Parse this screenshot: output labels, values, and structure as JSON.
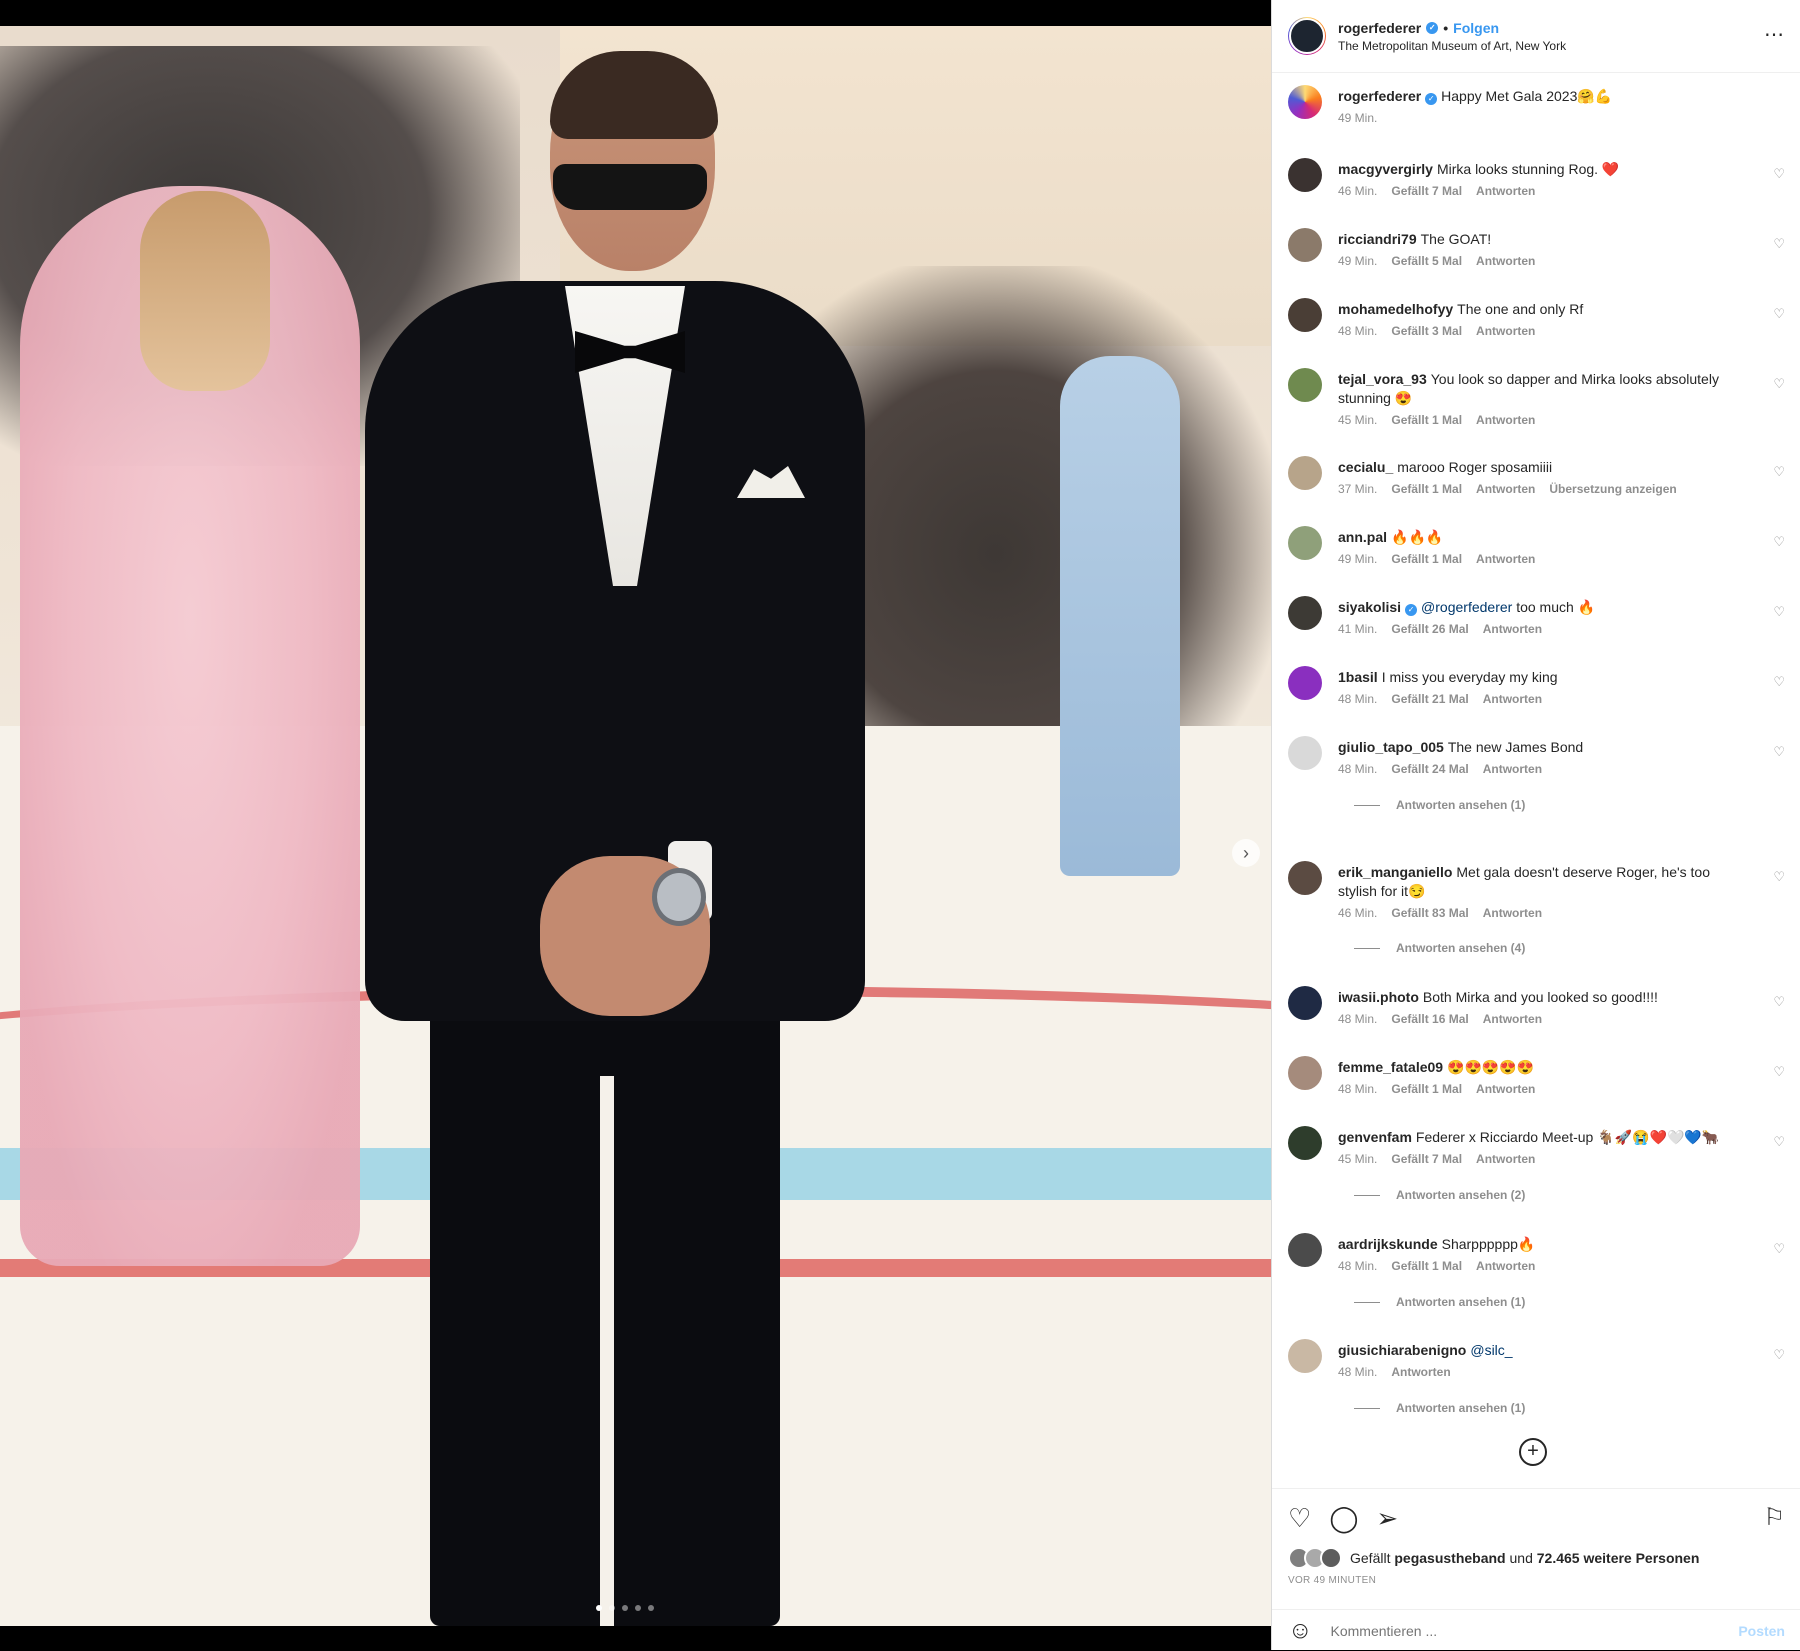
{
  "post": {
    "username": "rogerfederer",
    "follow_label": "Folgen",
    "separator": "•",
    "location": "The Metropolitan Museum of Art, New York",
    "more_icon": "⋯",
    "caption": "Happy Met Gala 2023🤗💪",
    "caption_time": "49 Min."
  },
  "colors": {
    "accent": "#3897f0",
    "text": "#262626",
    "muted": "#8e8e8e"
  },
  "comments": [
    {
      "user": "macgyvergirly",
      "text": "Mirka looks stunning Rog. ❤️",
      "time": "46 Min.",
      "likes": "Gefällt 7 Mal",
      "reply": "Antworten"
    },
    {
      "user": "ricciandri79",
      "text": "The GOAT!",
      "time": "49 Min.",
      "likes": "Gefällt 5 Mal",
      "reply": "Antworten"
    },
    {
      "user": "mohamedelhofyy",
      "text": "The one and only Rf",
      "time": "48 Min.",
      "likes": "Gefällt 3 Mal",
      "reply": "Antworten"
    },
    {
      "user": "tejal_vora_93",
      "text": "You look so dapper and Mirka looks absolutely stunning 😍",
      "time": "45 Min.",
      "likes": "Gefällt 1 Mal",
      "reply": "Antworten"
    },
    {
      "user": "cecialu_",
      "text": "marooo Roger sposamiiii",
      "time": "37 Min.",
      "likes": "Gefällt 1 Mal",
      "reply": "Antworten",
      "translate": "Übersetzung anzeigen"
    },
    {
      "user": "ann.pal",
      "text": "🔥🔥🔥",
      "time": "49 Min.",
      "likes": "Gefällt 1 Mal",
      "reply": "Antworten"
    },
    {
      "user": "siyakolisi",
      "mention": "@rogerfederer",
      "text": "too much 🔥",
      "time": "41 Min.",
      "likes": "Gefällt 26 Mal",
      "reply": "Antworten"
    },
    {
      "user": "1basil",
      "text": "I miss you everyday my king",
      "time": "48 Min.",
      "likes": "Gefällt 21 Mal",
      "reply": "Antworten"
    },
    {
      "user": "giulio_tapo_005",
      "text": "The new James Bond",
      "time": "48 Min.",
      "likes": "Gefällt 24 Mal",
      "reply": "Antworten",
      "view_replies": "Antworten ansehen (1)"
    },
    {
      "user": "erik_manganiello",
      "text": "Met gala doesn't deserve Roger, he's too stylish for it😏",
      "time": "46 Min.",
      "likes": "Gefällt 83 Mal",
      "reply": "Antworten",
      "view_replies": "Antworten ansehen (4)"
    },
    {
      "user": "iwasii.photo",
      "text": "Both Mirka and you looked so good!!!!",
      "time": "48 Min.",
      "likes": "Gefällt 16 Mal",
      "reply": "Antworten"
    },
    {
      "user": "femme_fatale09",
      "text": "😍😍😍😍😍",
      "time": "48 Min.",
      "likes": "Gefällt 1 Mal",
      "reply": "Antworten"
    },
    {
      "user": "genvenfam",
      "text": "Federer x Ricciardo Meet-up 🐐🚀😭❤️🤍💙🐂",
      "time": "45 Min.",
      "likes": "Gefällt 7 Mal",
      "reply": "Antworten",
      "view_replies": "Antworten ansehen (2)"
    },
    {
      "user": "aardrijkskunde",
      "text": "Sharpppppp🔥",
      "time": "48 Min.",
      "likes": "Gefällt 1 Mal",
      "reply": "Antworten",
      "view_replies": "Antworten ansehen (1)"
    },
    {
      "user": "giusichiarabenigno",
      "mention": "@silc_",
      "text": "",
      "time": "48 Min.",
      "reply": "Antworten",
      "view_replies": "Antworten ansehen (1)"
    }
  ],
  "actions": {
    "likes_prefix": "Gefällt",
    "likes_user": "pegasustheband",
    "likes_mid": "und",
    "likes_count": "72.465 weitere Personen",
    "time_ago": "VOR 49 MINUTEN",
    "comment_placeholder": "Kommentieren ...",
    "post_label": "Posten"
  },
  "icons": {
    "heart": "heart-icon",
    "comment": "comment-icon",
    "share": "share-icon",
    "save": "bookmark-icon",
    "emoji": "emoji-icon",
    "load_more": "plus-circle-icon",
    "next": "chevron-right-icon"
  }
}
